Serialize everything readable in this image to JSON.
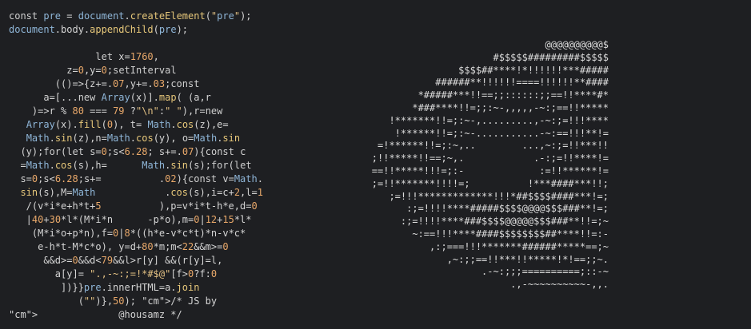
{
  "code_lines": [
    "const pre = document.createElement(\"pre\");",
    "document.body.appendChild(pre);",
    "",
    "               let x=1760,",
    "          z=0,y=0;setInterval",
    "        (()=>{z+=.07,y+=.03;const",
    "      a=[...new Array(x)].map( (a,r",
    "    )=>r % 80 === 79 ?\"\\n\":\" \"),r=new",
    "   Array(x).fill(0), t= Math.cos(z),e=",
    "   Math.sin(z),n=Math.cos(y), o=Math.sin",
    "  (y);for(let s=0;s<6.28; s+=.07){const c",
    "  =Math.cos(s),h=      Math.sin(s);for(let",
    "  s=0;s<6.28;s+=          .02){const v=Math.",
    "  sin(s),M=Math            .cos(s),i=c+2,l=1",
    "   /(v*i*e+h*t+5          ),p=v*i*t-h*e,d=0",
    "   |40+30*l*(M*i*n      -p*o),m=0|12+15*l*",
    "    (M*i*o+p*n),f=0|8*((h*e-v*c*t)*n-v*c*",
    "     e-h*t-M*c*o), y=d+80*m;m<22&&m>=0",
    "      &&d>=0&&d<79&&l>r[y] &&(r[y]=l,",
    "        a[y]= \".,-~:;=!*#$@\"[f>0?f:0",
    "         ])}}pre.innerHTML=a.join",
    "            (\"\")},50); /* JS by",
    "              @housamz */"
  ],
  "art_lines": [
    "@@@@@@@@@@$",
    "#$$$$$#########$$$$$",
    "$$$$##****!*!!!!!!***#####",
    "######**!!!!!!====!!!!!!**####",
    "*#####***!!==;;::::::;;==!!****#*",
    "*###****!!=;;:~-,,,,,-~:;==!!*****",
    "!*******!!=;:~-,.........,-~:;=!!!****",
    "!******!!=;:~-...........-~:==!!!**!=",
    "=!******!!=;:~,..        ...,~:;=!!***!!",
    ";!!*****!!==;~,.            .-:;=!!****!=",
    "==!!*****!!!=;:-             :=!!******!=",
    ";=!!*******!!!!=;          !***####***!!;",
    ";=!!!*************!!!*##$$$$####***!=;",
    ":;=!!!!****#####$$$$@@@@$$$###**!=;",
    ":;=!!!!****###$$$$@@@@@$$$###**!!=;~",
    "~:==!!!****####$$$$$$$$##****!!=:-",
    ",:;===!!!*******######*****==;~",
    ",~:;;==!!***!!*****!*!==;;~.",
    ".-~:;;;==========;::-~",
    ".,-~~~~~~~~~~-,,."
  ]
}
